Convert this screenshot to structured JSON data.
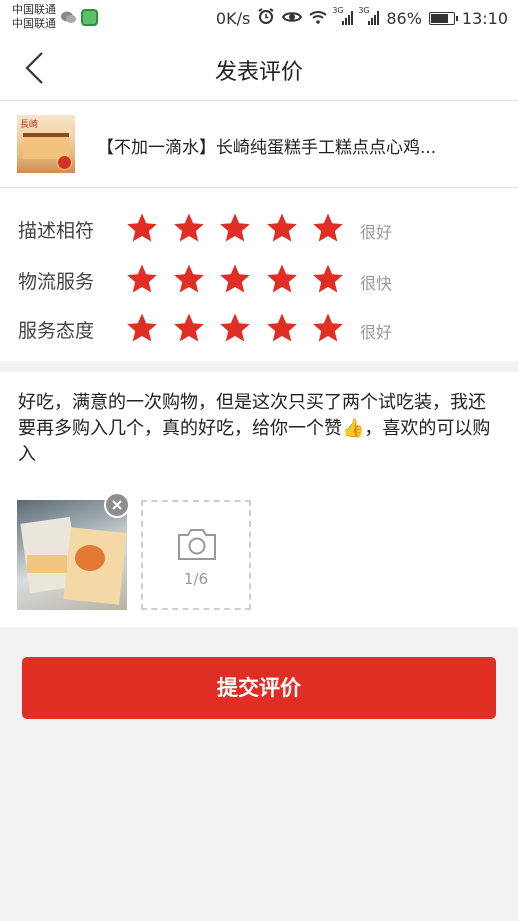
{
  "status_bar": {
    "carrier_1": "中国联通",
    "carrier_2": "中国联通",
    "speed": "0K/s",
    "net_1": "3G",
    "net_2": "3G",
    "battery": "86%",
    "battery_level": 0.86,
    "time": "13:10"
  },
  "header": {
    "title": "发表评价",
    "back_icon": "chevron-left-icon"
  },
  "product": {
    "name": "【不加一滴水】长崎纯蛋糕手工糕点点心鸡..."
  },
  "ratings": [
    {
      "label": "描述相符",
      "stars": 5,
      "max": 5,
      "word": "很好"
    },
    {
      "label": "物流服务",
      "stars": 5,
      "max": 5,
      "word": "很快"
    },
    {
      "label": "服务态度",
      "stars": 5,
      "max": 5,
      "word": "很好"
    }
  ],
  "review": {
    "text": "好吃，满意的一次购物，但是这次只买了两个试吃装，我还要再多购入几个，真的好吃，给你一个赞👍，喜欢的可以购入"
  },
  "photos": {
    "count_label": "1/6",
    "camera_icon": "camera-icon",
    "remove_icon": "close-icon"
  },
  "submit": {
    "label": "提交评价"
  },
  "colors": {
    "accent": "#e02e24",
    "star": "#e02e24"
  }
}
